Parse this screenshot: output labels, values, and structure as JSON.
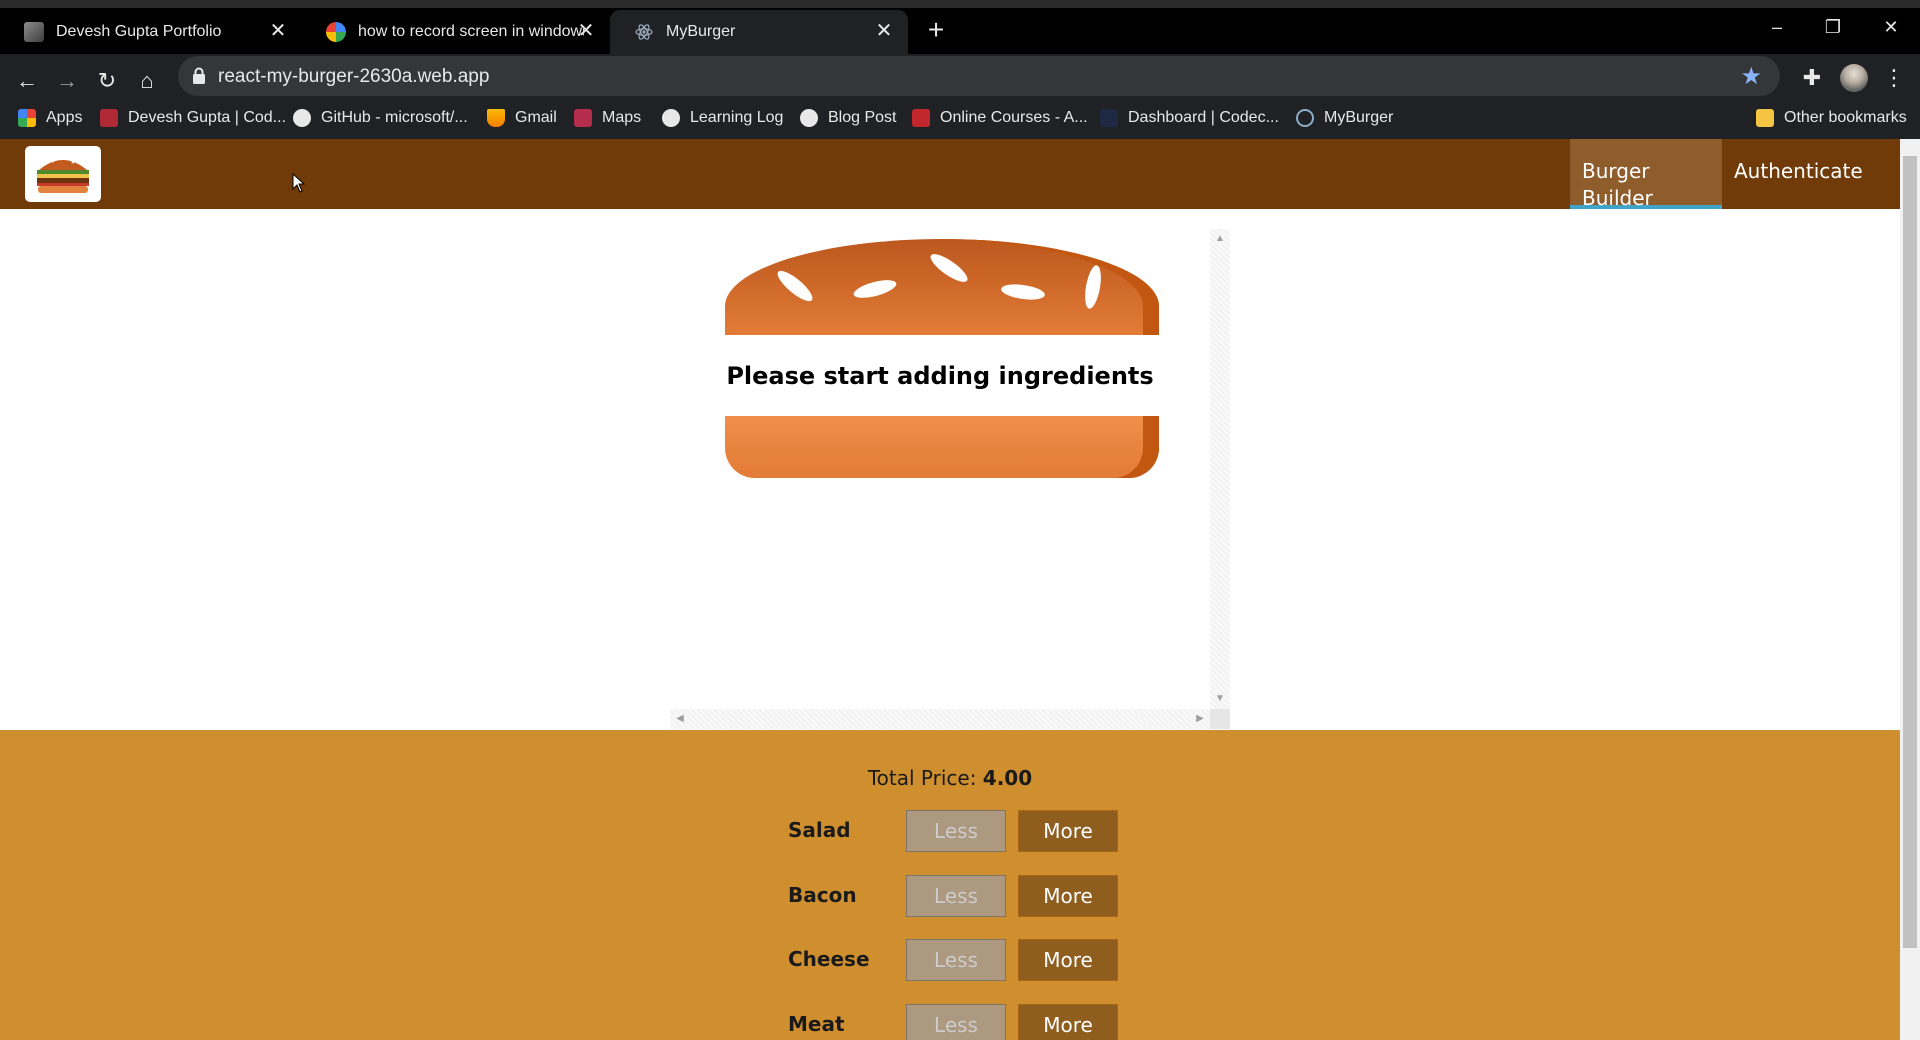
{
  "browser": {
    "tabs": [
      {
        "title": "Devesh Gupta Portfolio",
        "active": false
      },
      {
        "title": "how to record screen in windows",
        "active": false
      },
      {
        "title": "MyBurger",
        "active": true
      }
    ],
    "new_tab_label": "+",
    "window_controls": {
      "minimize": "–",
      "restore": "❐",
      "close": "✕"
    },
    "url": "react-my-burger-2630a.web.app",
    "bookmarks": [
      {
        "label": "Apps",
        "icon": "apps-grid-icon"
      },
      {
        "label": "Devesh Gupta | Cod...",
        "icon": "codepen-icon"
      },
      {
        "label": "GitHub - microsoft/...",
        "icon": "github-icon"
      },
      {
        "label": "Gmail",
        "icon": "firebase-icon"
      },
      {
        "label": "Maps",
        "icon": "maps-icon"
      },
      {
        "label": "Learning Log",
        "icon": "globe-icon"
      },
      {
        "label": "Blog Post",
        "icon": "globe-icon"
      },
      {
        "label": "Online Courses - A...",
        "icon": "udemy-icon"
      },
      {
        "label": "Dashboard | Codec...",
        "icon": "codechef-icon"
      },
      {
        "label": "MyBurger",
        "icon": "react-icon"
      }
    ],
    "other_bookmarks": "Other bookmarks"
  },
  "app": {
    "nav": [
      {
        "label": "Burger Builder",
        "active": true
      },
      {
        "label": "Authenticate",
        "active": false
      }
    ],
    "empty_message": "Please start adding ingredients",
    "price_label": "Total Price:",
    "price_value": "4.00",
    "controls": [
      {
        "label": "Salad",
        "less": "Less",
        "more": "More"
      },
      {
        "label": "Bacon",
        "less": "Less",
        "more": "More"
      },
      {
        "label": "Cheese",
        "less": "Less",
        "more": "More"
      },
      {
        "label": "Meat",
        "less": "Less",
        "more": "More"
      }
    ]
  },
  "colors": {
    "toolbar_bg": "#703b09",
    "nav_active_bg": "#8f5c2c",
    "nav_active_border": "#40a4c8",
    "controls_bg": "#cf8f2e",
    "more_btn": "#8f5e1e",
    "less_btn": "#ac9980"
  }
}
